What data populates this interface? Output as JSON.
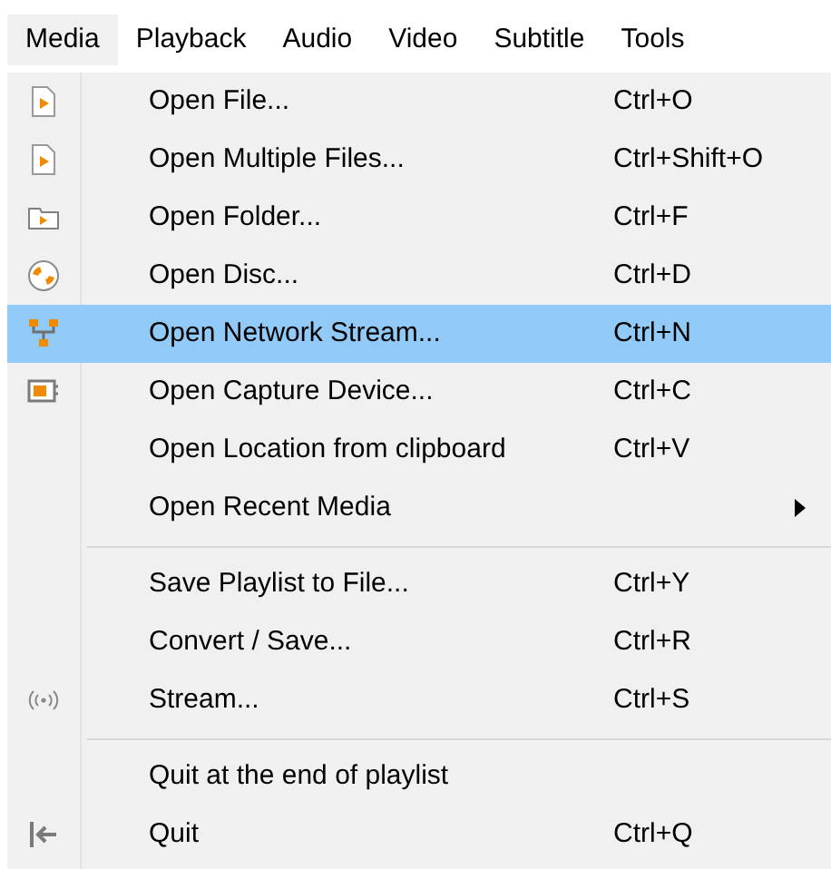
{
  "menubar": [
    {
      "label": "Media",
      "selected": true
    },
    {
      "label": "Playback",
      "selected": false
    },
    {
      "label": "Audio",
      "selected": false
    },
    {
      "label": "Video",
      "selected": false
    },
    {
      "label": "Subtitle",
      "selected": false
    },
    {
      "label": "Tools",
      "selected": false
    }
  ],
  "menu": [
    {
      "kind": "item",
      "label": "Open File...",
      "shortcut": "Ctrl+O",
      "selected": false
    },
    {
      "kind": "item",
      "label": "Open Multiple Files...",
      "shortcut": "Ctrl+Shift+O",
      "selected": false
    },
    {
      "kind": "item",
      "label": "Open Folder...",
      "shortcut": "Ctrl+F",
      "selected": false
    },
    {
      "kind": "item",
      "label": "Open Disc...",
      "shortcut": "Ctrl+D",
      "selected": false
    },
    {
      "kind": "item",
      "label": "Open Network Stream...",
      "shortcut": "Ctrl+N",
      "selected": true
    },
    {
      "kind": "item",
      "label": "Open Capture Device...",
      "shortcut": "Ctrl+C",
      "selected": false
    },
    {
      "kind": "item",
      "label": "Open Location from clipboard",
      "shortcut": "Ctrl+V",
      "selected": false
    },
    {
      "kind": "submenu",
      "label": "Open Recent Media",
      "selected": false
    },
    {
      "kind": "separator"
    },
    {
      "kind": "item",
      "label": "Save Playlist to File...",
      "shortcut": "Ctrl+Y",
      "selected": false
    },
    {
      "kind": "item",
      "label": "Convert / Save...",
      "shortcut": "Ctrl+R",
      "selected": false
    },
    {
      "kind": "item",
      "label": "Stream...",
      "shortcut": "Ctrl+S",
      "selected": false
    },
    {
      "kind": "separator"
    },
    {
      "kind": "item",
      "label": "Quit at the end of playlist",
      "selected": false
    },
    {
      "kind": "item",
      "label": "Quit",
      "shortcut": "Ctrl+Q",
      "selected": false
    }
  ]
}
